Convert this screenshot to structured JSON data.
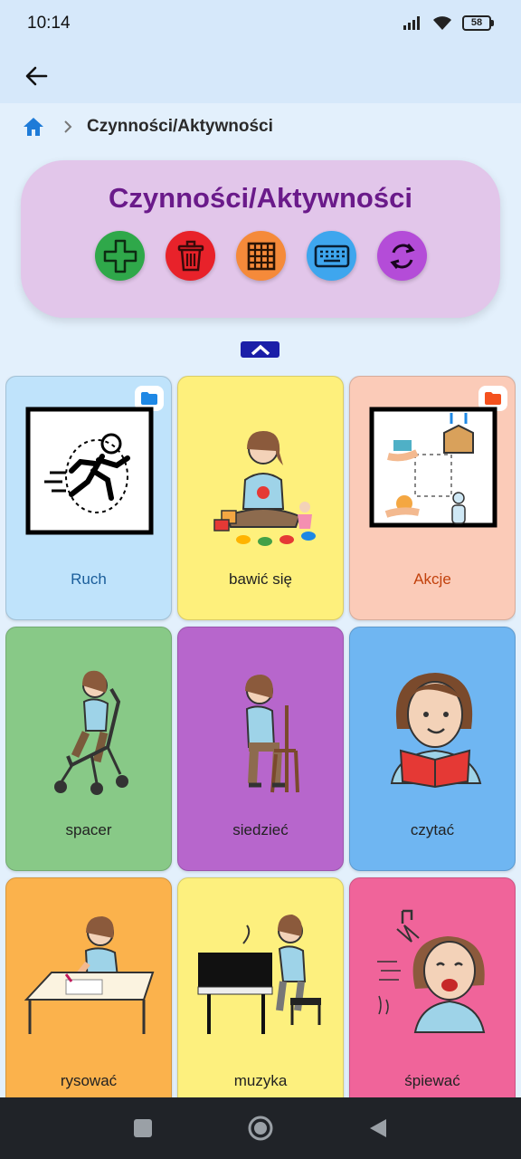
{
  "status_bar": {
    "time": "10:14",
    "battery": "58"
  },
  "breadcrumb": {
    "current": "Czynności/Aktywności"
  },
  "header": {
    "title": "Czynności/Aktywności"
  },
  "actions": [
    {
      "name": "add",
      "icon": "plus-icon",
      "color": "#2fa84a"
    },
    {
      "name": "delete",
      "icon": "trash-icon",
      "color": "#e8222a"
    },
    {
      "name": "grid",
      "icon": "grid-icon",
      "color": "#f58a3a"
    },
    {
      "name": "keyboard",
      "icon": "keyboard-icon",
      "color": "#3ea6ee"
    },
    {
      "name": "refresh",
      "icon": "refresh-icon",
      "color": "#b44cd8"
    }
  ],
  "tiles": [
    {
      "label": "Ruch",
      "bg": "#bfe3fb",
      "label_color": "#1a5d9a",
      "folder": true,
      "folder_color": "#1e88e5",
      "icon": "running-person-icon"
    },
    {
      "label": "bawić się",
      "bg": "#fef07c",
      "label_color": "#222222",
      "folder": false,
      "icon": "playing-with-toys-icon"
    },
    {
      "label": "Akcje",
      "bg": "#fbcbb8",
      "label_color": "#c2410c",
      "folder": true,
      "folder_color": "#f4511e",
      "icon": "actions-icon"
    },
    {
      "label": "spacer",
      "bg": "#88c987",
      "label_color": "#222222",
      "folder": false,
      "icon": "stroller-walk-icon"
    },
    {
      "label": "siedzieć",
      "bg": "#b766cc",
      "label_color": "#222222",
      "folder": false,
      "icon": "sitting-on-chair-icon"
    },
    {
      "label": "czytać",
      "bg": "#6fb6f2",
      "label_color": "#222222",
      "folder": false,
      "icon": "reading-book-icon"
    },
    {
      "label": "rysować",
      "bg": "#fbb24c",
      "label_color": "#222222",
      "folder": false,
      "icon": "drawing-icon"
    },
    {
      "label": "muzyka",
      "bg": "#fdf07e",
      "label_color": "#222222",
      "folder": false,
      "icon": "piano-music-icon"
    },
    {
      "label": "śpiewać",
      "bg": "#f0649a",
      "label_color": "#222222",
      "folder": false,
      "icon": "singing-icon"
    }
  ]
}
